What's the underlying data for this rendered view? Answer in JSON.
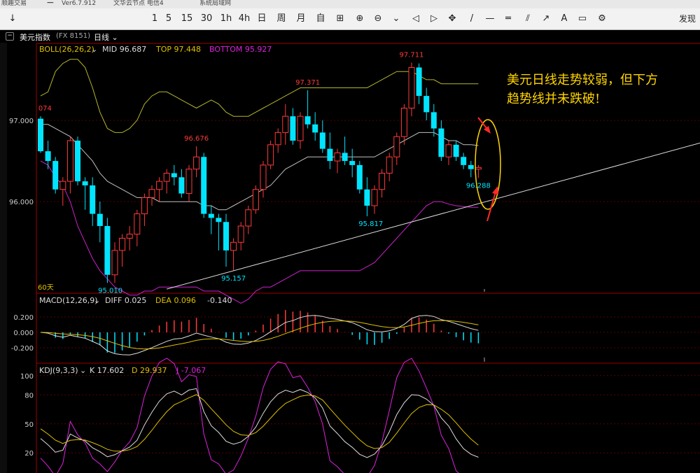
{
  "titlebar": {
    "app": "顺趣交易",
    "version": "Ver6.7.912",
    "center_items": [
      "文华云节点 电信4",
      "系统局域网"
    ],
    "right_label": "发现"
  },
  "toolbar": {
    "items": [
      "1",
      "5",
      "15",
      "30",
      "1h",
      "4h",
      "日",
      "周",
      "月",
      "自"
    ],
    "icons": [
      "grid-icon",
      "zoom-in-icon",
      "zoom-out-icon",
      "scroll-down-icon",
      "scroll-up-icon",
      "scroll-left-icon",
      "scroll-right-icon",
      "drag-icon",
      "line-tool-icon",
      "ray-tool-icon",
      "parallel-tool-icon",
      "fib-tool-icon",
      "arrow-tool-icon",
      "text-tool-icon",
      "box-tool-icon",
      "settings-icon"
    ]
  },
  "header": {
    "symbol": "美元指数",
    "code": "(FX 8151)",
    "period": "日线"
  },
  "boll": {
    "label": "BOLL(26,26,2)",
    "mid": "MID 96.687",
    "top": "TOP 97.448",
    "bottom": "BOTTOM 95.927"
  },
  "macd": {
    "label": "MACD(12,26,9)",
    "diff": "DIFF 0.025",
    "dea": "DEA 0.096",
    "macd": "-0.140"
  },
  "kdj": {
    "label": "KDJ(9,3,3)",
    "k": "K 17.602",
    "d": "D 29.937",
    "j": "J -7.067"
  },
  "axis": {
    "price_ticks": [
      "97.000",
      "96.000"
    ],
    "macd_ticks": [
      "0.200",
      "0.000",
      "-0.200"
    ],
    "kdj_ticks": [
      "100",
      "80",
      "50",
      "20"
    ]
  },
  "price_labels": {
    "left": "074",
    "high1": "96.676",
    "low1": "95.010",
    "high2": "97.371",
    "low2": "95.157",
    "high3": "97.711",
    "low3": "95.817",
    "last": "96.288",
    "range": "60天"
  },
  "annotation": {
    "line1": "美元日线走势较弱，但下方",
    "line2": "趋势线并未跌破!"
  },
  "colors": {
    "up": "#ff3a3a",
    "down": "#00e5ff",
    "boll_band": "#b5b52a",
    "boll_mid": "#bfbfbf",
    "boll_bottom": "#cc22cc",
    "annotation": "#ffd400"
  },
  "chart_data": {
    "type": "candlestick",
    "candles_ohlc": [
      [
        97.02,
        97.05,
        96.6,
        96.62
      ],
      [
        96.62,
        96.75,
        96.4,
        96.5
      ],
      [
        96.5,
        96.55,
        96.1,
        96.15
      ],
      [
        96.15,
        96.3,
        95.95,
        96.25
      ],
      [
        96.25,
        96.8,
        96.1,
        96.75
      ],
      [
        96.75,
        96.8,
        96.2,
        96.25
      ],
      [
        96.25,
        96.3,
        95.9,
        96.2
      ],
      [
        96.2,
        96.3,
        95.7,
        95.85
      ],
      [
        95.85,
        96.0,
        95.5,
        95.7
      ],
      [
        95.7,
        95.8,
        95.0,
        95.1
      ],
      [
        95.1,
        95.5,
        95.0,
        95.4
      ],
      [
        95.4,
        95.6,
        95.2,
        95.55
      ],
      [
        95.55,
        95.7,
        95.4,
        95.6
      ],
      [
        95.6,
        95.9,
        95.45,
        95.85
      ],
      [
        95.85,
        96.1,
        95.7,
        96.05
      ],
      [
        96.05,
        96.2,
        95.95,
        96.15
      ],
      [
        96.15,
        96.3,
        96.0,
        96.25
      ],
      [
        96.25,
        96.4,
        96.1,
        96.35
      ],
      [
        96.35,
        96.45,
        96.2,
        96.3
      ],
      [
        96.3,
        96.4,
        96.05,
        96.1
      ],
      [
        96.1,
        96.45,
        96.0,
        96.4
      ],
      [
        96.4,
        96.68,
        96.3,
        96.55
      ],
      [
        96.55,
        96.6,
        95.8,
        95.85
      ],
      [
        95.85,
        95.95,
        95.6,
        95.8
      ],
      [
        95.8,
        95.85,
        95.4,
        95.75
      ],
      [
        95.75,
        95.85,
        95.2,
        95.4
      ],
      [
        95.4,
        95.55,
        95.15,
        95.5
      ],
      [
        95.5,
        95.75,
        95.4,
        95.7
      ],
      [
        95.7,
        95.95,
        95.6,
        95.9
      ],
      [
        95.9,
        96.2,
        95.85,
        96.15
      ],
      [
        96.15,
        96.5,
        96.05,
        96.45
      ],
      [
        96.45,
        96.75,
        96.4,
        96.7
      ],
      [
        96.7,
        96.9,
        96.6,
        96.85
      ],
      [
        96.85,
        97.2,
        96.7,
        97.05
      ],
      [
        97.05,
        97.15,
        96.7,
        96.75
      ],
      [
        96.75,
        97.1,
        96.65,
        97.05
      ],
      [
        97.05,
        97.37,
        96.9,
        96.95
      ],
      [
        96.95,
        97.1,
        96.75,
        96.85
      ],
      [
        96.85,
        97.0,
        96.6,
        96.65
      ],
      [
        96.65,
        96.85,
        96.4,
        96.5
      ],
      [
        96.5,
        96.65,
        96.35,
        96.6
      ],
      [
        96.6,
        96.8,
        96.45,
        96.5
      ],
      [
        96.5,
        96.65,
        96.3,
        96.45
      ],
      [
        96.45,
        96.5,
        96.1,
        96.15
      ],
      [
        96.15,
        96.3,
        95.82,
        95.95
      ],
      [
        95.95,
        96.2,
        95.85,
        96.15
      ],
      [
        96.15,
        96.4,
        96.05,
        96.35
      ],
      [
        96.35,
        96.6,
        96.25,
        96.55
      ],
      [
        96.55,
        96.85,
        96.45,
        96.8
      ],
      [
        96.8,
        97.2,
        96.7,
        97.15
      ],
      [
        97.15,
        97.71,
        97.05,
        97.65
      ],
      [
        97.65,
        97.7,
        97.2,
        97.3
      ],
      [
        97.3,
        97.4,
        97.0,
        97.1
      ],
      [
        97.1,
        97.2,
        96.8,
        96.9
      ],
      [
        96.9,
        97.0,
        96.5,
        96.55
      ],
      [
        96.55,
        96.75,
        96.45,
        96.7
      ],
      [
        96.7,
        96.75,
        96.5,
        96.55
      ],
      [
        96.55,
        96.6,
        96.4,
        96.45
      ],
      [
        96.45,
        96.5,
        96.3,
        96.4
      ],
      [
        96.4,
        96.45,
        96.29,
        96.42
      ]
    ],
    "boll_top": [
      97.3,
      97.35,
      97.6,
      97.7,
      97.75,
      97.75,
      97.65,
      97.4,
      97.1,
      96.9,
      96.85,
      96.85,
      96.9,
      97.0,
      97.2,
      97.3,
      97.35,
      97.35,
      97.3,
      97.25,
      97.2,
      97.15,
      97.2,
      97.25,
      97.2,
      97.1,
      97.05,
      97.05,
      97.05,
      97.1,
      97.15,
      97.2,
      97.25,
      97.3,
      97.35,
      97.4,
      97.4,
      97.4,
      97.4,
      97.4,
      97.4,
      97.4,
      97.4,
      97.4,
      97.4,
      97.45,
      97.5,
      97.55,
      97.6,
      97.6,
      97.6,
      97.55,
      97.5,
      97.5,
      97.45,
      97.45,
      97.45,
      97.45,
      97.45,
      97.45
    ],
    "boll_mid": [
      96.95,
      96.95,
      96.9,
      96.85,
      96.8,
      96.7,
      96.6,
      96.5,
      96.35,
      96.25,
      96.2,
      96.15,
      96.1,
      96.05,
      96.05,
      96.05,
      96.0,
      96.0,
      96.0,
      96.0,
      96.0,
      96.0,
      95.95,
      95.95,
      95.9,
      95.9,
      95.95,
      96.0,
      96.05,
      96.1,
      96.15,
      96.2,
      96.3,
      96.4,
      96.45,
      96.5,
      96.55,
      96.55,
      96.55,
      96.55,
      96.55,
      96.55,
      96.55,
      96.55,
      96.55,
      96.55,
      96.6,
      96.65,
      96.7,
      96.75,
      96.8,
      96.85,
      96.85,
      96.85,
      96.8,
      96.75,
      96.75,
      96.7,
      96.7,
      96.69
    ],
    "boll_bottom": [
      96.5,
      96.45,
      96.3,
      96.2,
      96.0,
      95.7,
      95.5,
      95.3,
      95.15,
      95.05,
      94.95,
      94.9,
      94.85,
      94.85,
      94.9,
      94.9,
      94.95,
      94.95,
      94.95,
      94.95,
      94.95,
      94.95,
      94.9,
      94.9,
      94.9,
      94.85,
      94.8,
      94.75,
      94.8,
      94.9,
      94.95,
      94.95,
      95.0,
      95.05,
      95.1,
      95.15,
      95.15,
      95.15,
      95.15,
      95.15,
      95.15,
      95.15,
      95.15,
      95.15,
      95.2,
      95.25,
      95.35,
      95.45,
      95.55,
      95.65,
      95.75,
      95.85,
      95.95,
      96.0,
      96.0,
      95.97,
      95.95,
      95.94,
      95.93,
      95.93
    ],
    "trendline": [
      [
        95.15,
        26
      ],
      [
        96.0,
        60
      ]
    ],
    "ylim_price": [
      94.9,
      97.8
    ]
  }
}
